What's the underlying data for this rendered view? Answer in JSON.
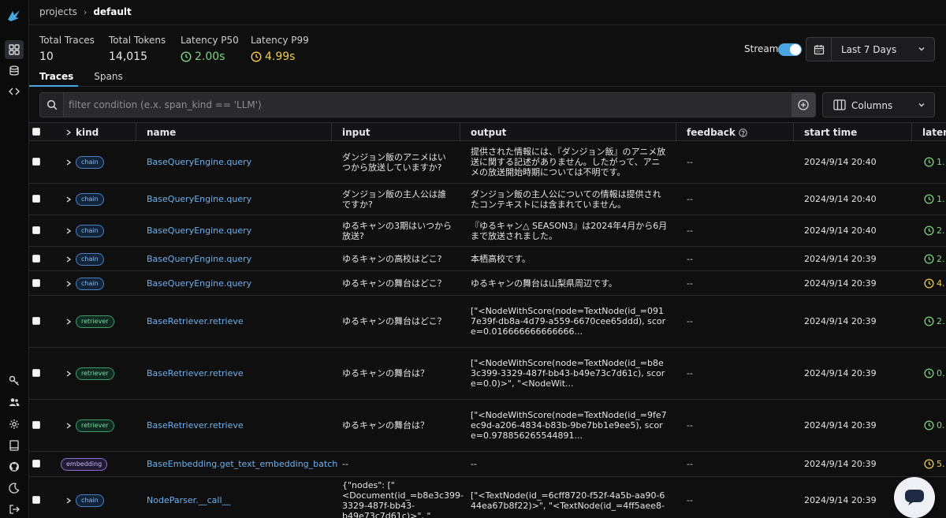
{
  "breadcrumb": {
    "root": "projects",
    "current": "default"
  },
  "stats": {
    "total_traces": {
      "label": "Total Traces",
      "value": "10"
    },
    "total_tokens": {
      "label": "Total Tokens",
      "value": "14,015"
    },
    "latency_p50": {
      "label": "Latency P50",
      "value": "2.00s"
    },
    "latency_p99": {
      "label": "Latency P99",
      "value": "4.99s"
    }
  },
  "stream": {
    "label": "Stream",
    "enabled": true
  },
  "time_range": {
    "value": "Last 7 Days"
  },
  "tabs": [
    {
      "label": "Traces",
      "active": true
    },
    {
      "label": "Spans",
      "active": false
    }
  ],
  "filter": {
    "placeholder": "filter condition (e.x. span_kind == 'LLM')",
    "value": ""
  },
  "columns_button": {
    "label": "Columns"
  },
  "table": {
    "headers": {
      "kind": "kind",
      "name": "name",
      "input": "input",
      "output": "output",
      "feedback": "feedback",
      "start_time": "start time",
      "latency": "latenc"
    },
    "rows": [
      {
        "kind": "chain",
        "name": "BaseQueryEngine.query",
        "input": "ダンジョン飯のアニメはいつから放送していますか?",
        "output": "提供された情報には、『ダンジョン飯』のアニメ放送に関する記述がありません。したがって、アニメの放送開始時期については不明です。",
        "feedback": "--",
        "start_time": "2024/9/14 20:40",
        "latency": "1.",
        "latency_color": "g"
      },
      {
        "kind": "chain",
        "name": "BaseQueryEngine.query",
        "input": "ダンジョン飯の主人公は誰ですか?",
        "output": "ダンジョン飯の主人公についての情報は提供されたコンテキストには含まれていません。",
        "feedback": "--",
        "start_time": "2024/9/14 20:40",
        "latency": "1.",
        "latency_color": "g"
      },
      {
        "kind": "chain",
        "name": "BaseQueryEngine.query",
        "input": "ゆるキャンの3期はいつから放送?",
        "output": "『ゆるキャン△ SEASON3』は2024年4月から6月まで放送されました。",
        "feedback": "--",
        "start_time": "2024/9/14 20:40",
        "latency": "2.",
        "latency_color": "g"
      },
      {
        "kind": "chain",
        "name": "BaseQueryEngine.query",
        "input": "ゆるキャンの高校はどこ?",
        "output": "本栖高校です。",
        "feedback": "--",
        "start_time": "2024/9/14 20:39",
        "latency": "2.",
        "latency_color": "g"
      },
      {
        "kind": "chain",
        "name": "BaseQueryEngine.query",
        "input": "ゆるキャンの舞台はどこ？",
        "output": "ゆるキャンの舞台は山梨県周辺です。",
        "feedback": "--",
        "start_time": "2024/9/14 20:39",
        "latency": "4.",
        "latency_color": "y"
      },
      {
        "kind": "retriever",
        "name": "BaseRetriever.retrieve",
        "input": "ゆるキャンの舞台はどこ？",
        "output": "[\"<NodeWithScore(node=TextNode(id_=0917e39f-db8a-4d79-a559-6670cee65ddd), score=0.016666666666666...",
        "feedback": "--",
        "start_time": "2024/9/14 20:39",
        "latency": "2.",
        "latency_color": "g"
      },
      {
        "kind": "retriever",
        "name": "BaseRetriever.retrieve",
        "input": "ゆるキャンの舞台は？",
        "output": "[\"<NodeWithScore(node=TextNode(id_=b8e3c399-3329-487f-bb43-b49e73c7d61c), score=0.0)>\", \"<NodeWit...",
        "feedback": "--",
        "start_time": "2024/9/14 20:39",
        "latency": "0.",
        "latency_color": "g"
      },
      {
        "kind": "retriever",
        "name": "BaseRetriever.retrieve",
        "input": "ゆるキャンの舞台は？",
        "output": "[\"<NodeWithScore(node=TextNode(id_=9fe7ec9d-a206-4834-b83b-9be7bb1e9ee5), score=0.978856265544891...",
        "feedback": "--",
        "start_time": "2024/9/14 20:39",
        "latency": "0.",
        "latency_color": "g"
      },
      {
        "kind": "embedding",
        "name": "BaseEmbedding.get_text_embedding_batch",
        "input": "--",
        "output": "--",
        "feedback": "--",
        "start_time": "2024/9/14 20:39",
        "latency": "5.",
        "latency_color": "y"
      },
      {
        "kind": "chain",
        "name": "NodeParser.__call__",
        "input": "{\"nodes\": [\"<Document(id_=b8e3c399-3329-487f-bb43-b49e73c7d61c)>\", \"",
        "output": "[\"<TextNode(id_=6cff8720-f52f-4a5b-aa90-644ea67b8f22)>\", \"<TextNode(id_=4ff5aee8-",
        "feedback": "--",
        "start_time": "2024/9/14 20:39",
        "latency": "",
        "latency_color": "g"
      }
    ]
  },
  "colors": {
    "accent": "#4aa6e0",
    "link": "#6fb1ee",
    "green": "#7fd67f",
    "yellow": "#f2cc4a"
  }
}
